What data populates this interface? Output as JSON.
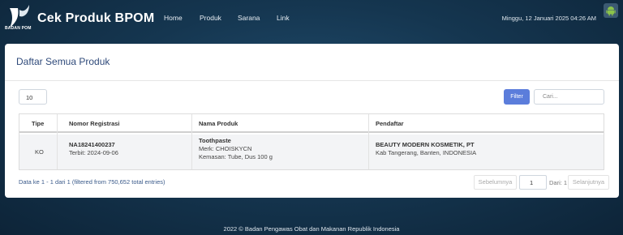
{
  "header": {
    "logo_text": "BADAN POM",
    "brand": "Cek Produk BPOM",
    "nav": [
      "Home",
      "Produk",
      "Sarana",
      "Link"
    ],
    "datetime": "Minggu, 12 Januari 2025 04:26 AM"
  },
  "card": {
    "title": "Daftar Semua Produk",
    "page_length": "10",
    "filter_label": "Filter",
    "search_placeholder": "Cari..."
  },
  "table": {
    "columns": [
      "Tipe",
      "Nomor Registrasi",
      "Nama Produk",
      "Pendaftar"
    ],
    "rows": [
      {
        "tipe": "KO",
        "nomor": "NA18241400237",
        "terbit": "Terbit: 2024-09-06",
        "nama": "Toothpaste",
        "merk": "Merk: CHOISKYCN",
        "kemasan": "Kemasan: Tube, Dus 100 g",
        "pendaftar": "BEAUTY MODERN KOSMETIK, PT",
        "lokasi": "Kab Tangerang, Banten, INDONESIA"
      }
    ]
  },
  "info": "Data ke 1 - 1 dari 1 (filtered from 750,652 total entries)",
  "pager": {
    "prev": "Sebelumnya",
    "page": "1",
    "of": "Dari: 1",
    "next": "Selanjutnya"
  },
  "footer": "2022 © Badan Pengawas Obat dan Makanan Republik Indonesia",
  "colors": {
    "accent": "#5b7ddb",
    "title": "#2f4a7a",
    "background": "#153650"
  }
}
